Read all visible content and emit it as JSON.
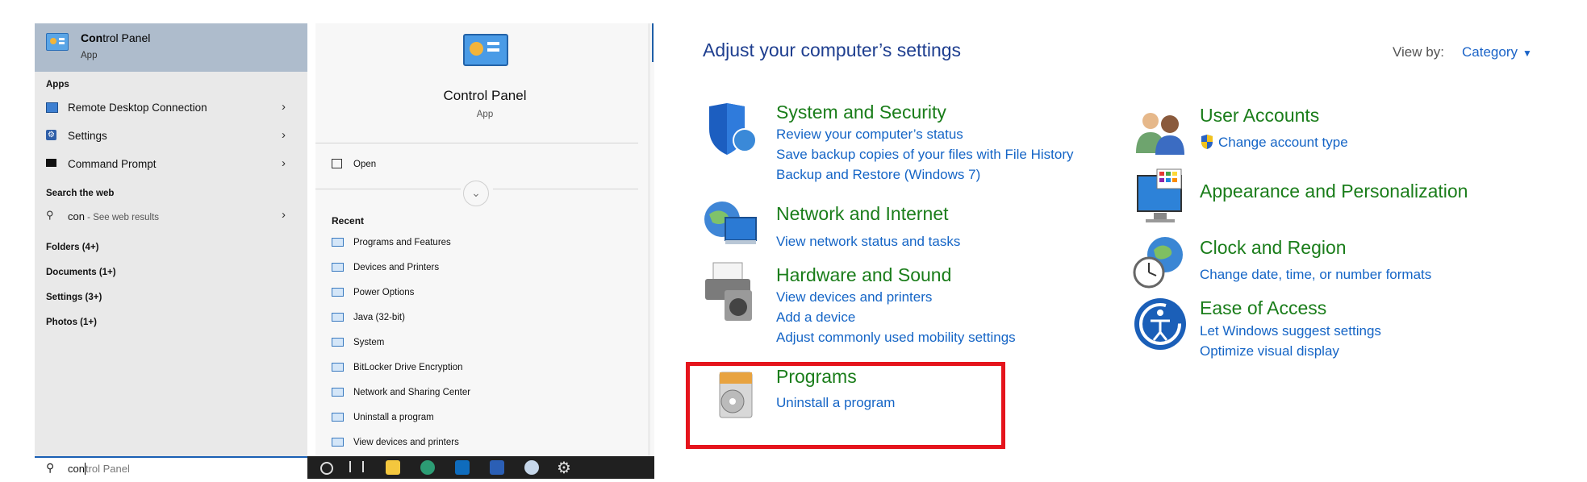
{
  "start_menu": {
    "best_match": {
      "title_bold": "Con",
      "title_rest": "trol Panel",
      "subtitle": "App"
    },
    "apps_header": "Apps",
    "apps": [
      {
        "label": "Remote Desktop Connection"
      },
      {
        "label": "Settings"
      },
      {
        "label": "Command Prompt"
      }
    ],
    "web_header": "Search the web",
    "web_query": "con",
    "web_suffix": " - See web results",
    "categories": [
      "Folders (4+)",
      "Documents (1+)",
      "Settings (3+)",
      "Photos (1+)"
    ],
    "detail": {
      "title": "Control Panel",
      "subtitle": "App",
      "open_label": "Open",
      "recent_header": "Recent",
      "recent": [
        "Programs and Features",
        "Devices and Printers",
        "Power Options",
        "Java (32-bit)",
        "System",
        "BitLocker Drive Encryption",
        "Network and Sharing Center",
        "Uninstall a program",
        "View devices and printers"
      ]
    },
    "search": {
      "typed": "con",
      "suggestion": "trol Panel"
    },
    "taskbar_icons": [
      "cortana-icon",
      "task-view-icon",
      "file-explorer-icon",
      "edge-icon",
      "outlook-icon",
      "word-icon",
      "paint-icon",
      "settings-icon"
    ]
  },
  "control_panel": {
    "title": "Adjust your computer’s settings",
    "view_by_label": "View by:",
    "view_by_value": "Category",
    "left_categories": [
      {
        "name": "System and Security",
        "icon": "shield-icon",
        "links": [
          "Review your computer’s status",
          "Save backup copies of your files with File History",
          "Backup and Restore (Windows 7)"
        ]
      },
      {
        "name": "Network and Internet",
        "icon": "network-globe-icon",
        "links": [
          "View network status and tasks"
        ]
      },
      {
        "name": "Hardware and Sound",
        "icon": "printer-speaker-icon",
        "links": [
          "View devices and printers",
          "Add a device",
          "Adjust commonly used mobility settings"
        ]
      },
      {
        "name": "Programs",
        "icon": "programs-disc-icon",
        "links": [
          "Uninstall a program"
        ]
      }
    ],
    "right_categories": [
      {
        "name": "User Accounts",
        "icon": "users-icon",
        "links": [
          "Change account type"
        ]
      },
      {
        "name": "Appearance and Personalization",
        "icon": "monitor-palette-icon",
        "links": []
      },
      {
        "name": "Clock and Region",
        "icon": "clock-globe-icon",
        "links": [
          "Change date, time, or number formats"
        ]
      },
      {
        "name": "Ease of Access",
        "icon": "ease-of-access-icon",
        "links": [
          "Let Windows suggest settings",
          "Optimize visual display"
        ]
      }
    ],
    "colors": {
      "heading_green": "#1a7d1a",
      "link_blue": "#1565c6",
      "title_blue": "#1e3e8f",
      "highlight_red": "#e5141c"
    }
  }
}
